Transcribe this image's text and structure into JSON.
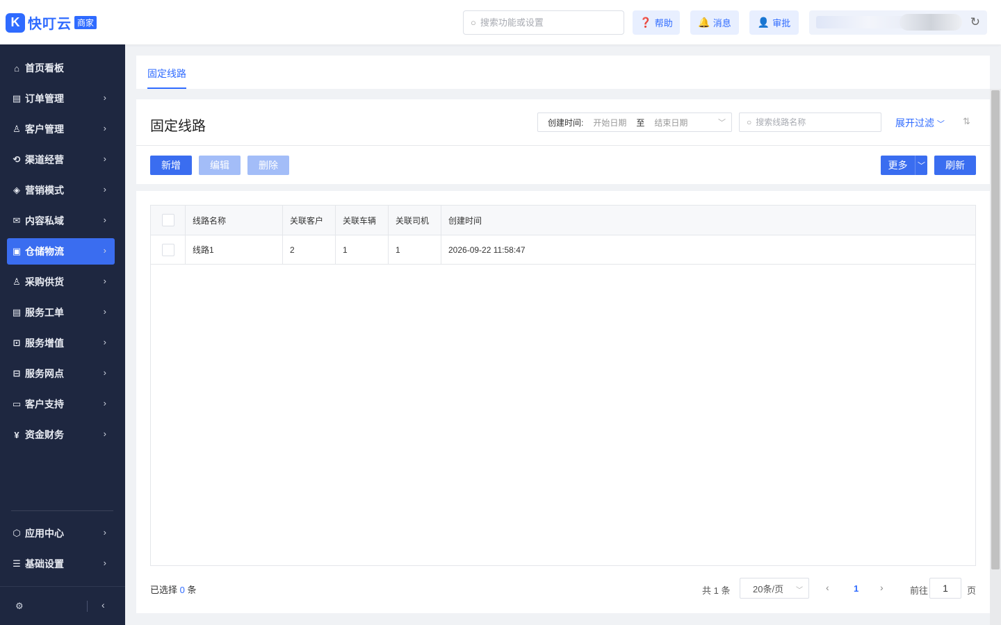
{
  "header": {
    "logo_mark": "K",
    "logo_text": "快叮云",
    "logo_badge": "商家",
    "search_placeholder": "搜索功能或设置",
    "help_label": "帮助",
    "messages_label": "消息",
    "approval_label": "审批"
  },
  "sidebar": {
    "items": [
      {
        "label": "首页看板",
        "icon": "⌂"
      },
      {
        "label": "订单管理",
        "icon": "▤"
      },
      {
        "label": "客户管理",
        "icon": "♙"
      },
      {
        "label": "渠道经营",
        "icon": "⟲"
      },
      {
        "label": "营销模式",
        "icon": "◈"
      },
      {
        "label": "内容私域",
        "icon": "✉"
      },
      {
        "label": "仓储物流",
        "icon": "▣"
      },
      {
        "label": "采购供货",
        "icon": "♙"
      },
      {
        "label": "服务工单",
        "icon": "▤"
      },
      {
        "label": "服务增值",
        "icon": "⊡"
      },
      {
        "label": "服务网点",
        "icon": "⊟"
      },
      {
        "label": "客户支持",
        "icon": "▭"
      },
      {
        "label": "资金财务",
        "icon": "¥"
      }
    ],
    "bottom_items": [
      {
        "label": "应用中心",
        "icon": "⬡"
      },
      {
        "label": "基础设置",
        "icon": "☰"
      }
    ],
    "active_index": 6
  },
  "tabs": [
    {
      "label": "固定线路"
    }
  ],
  "page": {
    "title": "固定线路",
    "date_label": "创建时间:",
    "start_placeholder": "开始日期",
    "to_label": "至",
    "end_placeholder": "结束日期",
    "line_search_placeholder": "搜索线路名称",
    "expand_filter_label": "展开过滤"
  },
  "toolbar": {
    "add_label": "新增",
    "edit_label": "编辑",
    "delete_label": "删除",
    "more_label": "更多",
    "refresh_label": "刷新"
  },
  "table": {
    "columns": [
      "线路名称",
      "关联客户",
      "关联车辆",
      "关联司机",
      "创建时间"
    ],
    "rows": [
      {
        "name": "线路1",
        "customers": "2",
        "vehicles": "1",
        "drivers": "1",
        "created": "2026-09-22 11:58:47"
      }
    ]
  },
  "footer": {
    "selected_prefix": "已选择",
    "selected_count": "0",
    "selected_suffix": "条",
    "total_text": "共 1 条",
    "page_size": "20条/页",
    "current_page": "1",
    "goto_label": "前往",
    "goto_value": "1",
    "page_suffix": "页"
  },
  "colors": {
    "primary": "#3a6df0",
    "sidebar_bg": "#1e2740",
    "disabled": "#a3bdf8"
  }
}
